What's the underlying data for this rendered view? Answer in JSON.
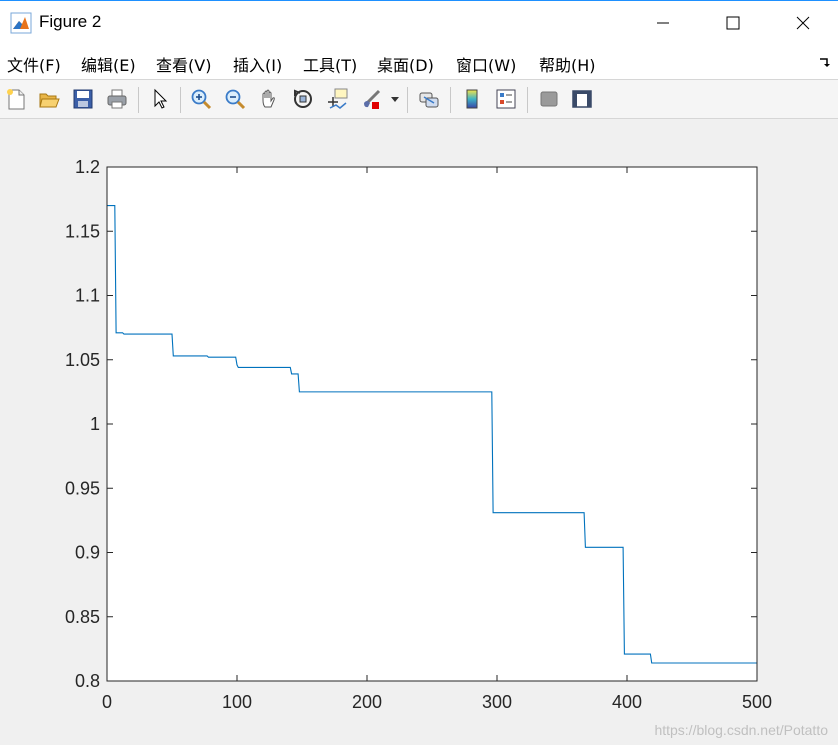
{
  "window": {
    "title": "Figure 2"
  },
  "menubar": {
    "items": [
      "文件(F)",
      "编辑(E)",
      "查看(V)",
      "插入(I)",
      "工具(T)",
      "桌面(D)",
      "窗口(W)",
      "帮助(H)"
    ],
    "dock_icon": "dock-arrow-icon"
  },
  "toolbar": {
    "buttons": [
      "new-figure-icon",
      "open-file-icon",
      "save-icon",
      "print-icon",
      "edit-plot-arrow-icon",
      "zoom-in-icon",
      "zoom-out-icon",
      "pan-hand-icon",
      "rotate-3d-icon",
      "data-cursor-icon",
      "brush-icon",
      "brush-dropdown-icon",
      "link-plot-icon",
      "colorbar-icon",
      "legend-icon",
      "hide-plot-tools-icon",
      "show-plot-tools-icon"
    ]
  },
  "watermark": "https://blog.csdn.net/Potatto",
  "chart_data": {
    "type": "line",
    "title": "",
    "xlabel": "",
    "ylabel": "",
    "xlim": [
      0,
      500
    ],
    "ylim": [
      0.8,
      1.2
    ],
    "xticks": [
      "0",
      "100",
      "200",
      "300",
      "400",
      "500"
    ],
    "yticks": [
      "0.8",
      "0.85",
      "0.9",
      "0.95",
      "1",
      "1.05",
      "1.1",
      "1.15",
      "1.2"
    ],
    "grid": false,
    "line_color": "#0072bd",
    "series": [
      {
        "x": [
          0,
          6,
          7,
          12,
          13,
          50,
          51,
          77,
          78,
          99,
          100,
          101,
          141,
          142,
          147,
          148,
          296,
          297,
          367,
          368,
          397,
          398,
          418,
          419,
          500
        ],
        "y": [
          1.17,
          1.17,
          1.071,
          1.071,
          1.07,
          1.07,
          1.053,
          1.053,
          1.052,
          1.052,
          1.046,
          1.044,
          1.044,
          1.039,
          1.039,
          1.025,
          1.025,
          0.931,
          0.931,
          0.904,
          0.904,
          0.821,
          0.821,
          0.814,
          0.814
        ]
      }
    ]
  }
}
